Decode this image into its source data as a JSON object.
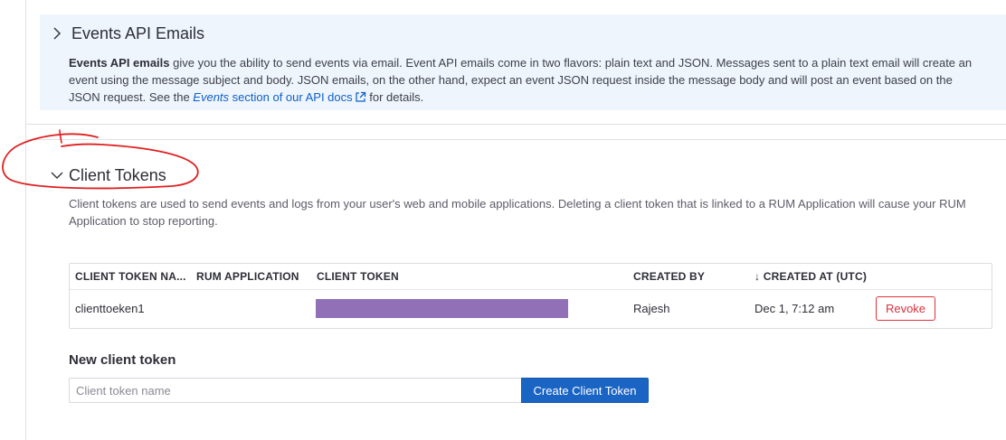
{
  "events_api": {
    "title": "Events API Emails",
    "desc_bold": "Events API emails",
    "desc_text": " give you the ability to send events via email. Event API emails come in two flavors: plain text and JSON. Messages sent to a plain text email will create an event using the message subject and body. JSON emails, on the other hand, expect an event JSON request inside the message body and will post an event based on the JSON request. See the ",
    "link_italic": "Events",
    "link_text": " section of our API docs",
    "desc_tail": " for details."
  },
  "client_tokens": {
    "title": "Client Tokens",
    "description": "Client tokens are used to send events and logs from your user's web and mobile applications. Deleting a client token that is linked to a RUM Application will cause your RUM Application to stop reporting.",
    "table": {
      "columns": [
        "CLIENT TOKEN NA...",
        "RUM APPLICATION",
        "CLIENT TOKEN",
        "CREATED BY",
        "↓ CREATED AT (UTC)"
      ],
      "rows": [
        {
          "name": "clienttoeken1",
          "rum_application": "",
          "created_by": "Rajesh",
          "created_at": "Dec 1, 7:12 am",
          "action": "Revoke"
        }
      ]
    },
    "new_token": {
      "label": "New client token",
      "placeholder": "Client token name",
      "value": "",
      "button": "Create Client Token"
    }
  },
  "colors": {
    "panel_bg": "#eef5fc",
    "link": "#1060c8",
    "primary_button": "#1a64c4",
    "danger": "#d8303a",
    "redaction": "#9170b8",
    "annotation": "#e02020"
  },
  "icons": {
    "events_chevron": "chevron-right-icon",
    "tokens_chevron": "chevron-down-icon",
    "external_link": "external-link-icon"
  }
}
